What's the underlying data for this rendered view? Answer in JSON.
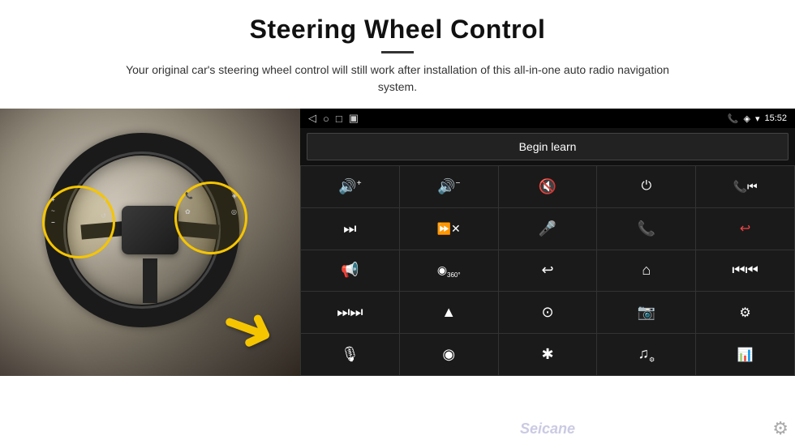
{
  "header": {
    "title": "Steering Wheel Control",
    "divider": true,
    "subtitle": "Your original car's steering wheel control will still work after installation of this all-in-one auto radio navigation system."
  },
  "status_bar": {
    "back_icon": "◁",
    "home_icon": "○",
    "recent_icon": "□",
    "signal_icon": "▣",
    "phone_icon": "📞",
    "location_icon": "◈",
    "wifi_icon": "▾",
    "time": "15:52"
  },
  "begin_learn": {
    "label": "Begin learn"
  },
  "controls": [
    {
      "icon": "🔊+",
      "name": "vol-up"
    },
    {
      "icon": "🔊−",
      "name": "vol-down"
    },
    {
      "icon": "🔇",
      "name": "mute"
    },
    {
      "icon": "⏻",
      "name": "power"
    },
    {
      "icon": "⏮",
      "name": "prev-track-phone"
    },
    {
      "icon": "⏭",
      "name": "next"
    },
    {
      "icon": "⏩✗",
      "name": "ff-cancel"
    },
    {
      "icon": "🎤",
      "name": "mic"
    },
    {
      "icon": "📞",
      "name": "call"
    },
    {
      "icon": "↩",
      "name": "hang-up"
    },
    {
      "icon": "📣",
      "name": "horn"
    },
    {
      "icon": "◎",
      "name": "camera-360"
    },
    {
      "icon": "↩",
      "name": "back"
    },
    {
      "icon": "⌂",
      "name": "home"
    },
    {
      "icon": "⏮⏮",
      "name": "prev-track"
    },
    {
      "icon": "⏭⏭",
      "name": "fast-forward"
    },
    {
      "icon": "▲",
      "name": "navigate"
    },
    {
      "icon": "⊙",
      "name": "eject"
    },
    {
      "icon": "📷",
      "name": "camera"
    },
    {
      "icon": "⚙",
      "name": "settings-eq"
    },
    {
      "icon": "🎤",
      "name": "mic2"
    },
    {
      "icon": "◉",
      "name": "dial"
    },
    {
      "icon": "✱",
      "name": "bluetooth"
    },
    {
      "icon": "♫",
      "name": "music"
    },
    {
      "icon": "📊",
      "name": "equalizer"
    }
  ],
  "watermark": "Seicane",
  "settings_icon": "⚙"
}
